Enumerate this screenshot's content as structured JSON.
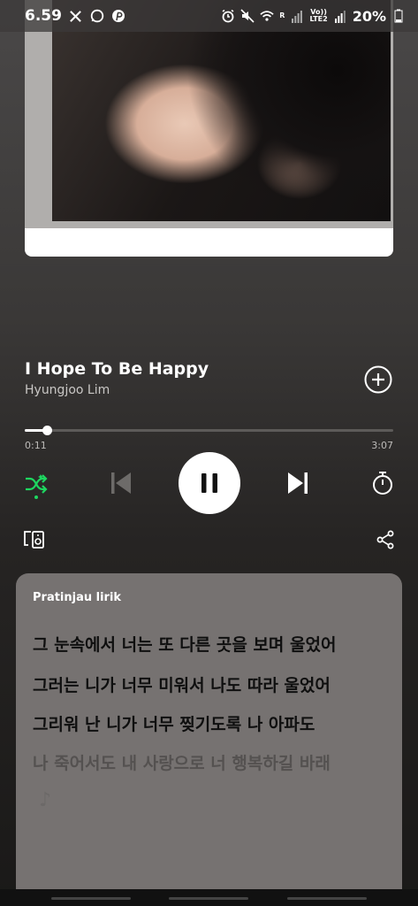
{
  "status_bar": {
    "time": "6.59",
    "battery": "20%",
    "left_icons": [
      "x-icon",
      "whatsapp-icon",
      "pinterest-icon"
    ],
    "right_icons": [
      "alarm-icon",
      "mute-icon",
      "wifi-icon",
      "signal-icon",
      "battery-icon"
    ],
    "roaming_label": "R",
    "volte_label_top": "Vo))",
    "volte_label_bottom": "LTE2"
  },
  "track": {
    "title": "I Hope To Be Happy",
    "artist": "Hyungjoo Lim"
  },
  "playback": {
    "elapsed": "0:11",
    "total": "3:07",
    "progress_fraction": 0.059,
    "shuffle_active": true,
    "state": "playing"
  },
  "colors": {
    "accent": "#1ed760",
    "lyrics_card": "#767271"
  },
  "lyrics": {
    "heading": "Pratinjau lirik",
    "lines": [
      "그 눈속에서 너는 또 다른 곳을 보며 울었어",
      "그러는 니가 너무 미워서 나도 따라 울었어",
      "그리워 난 니가 너무 찢기도록 나 아파도",
      "나 죽어서도 내 사랑으로 너 행복하길 바래"
    ],
    "note": "♪"
  }
}
